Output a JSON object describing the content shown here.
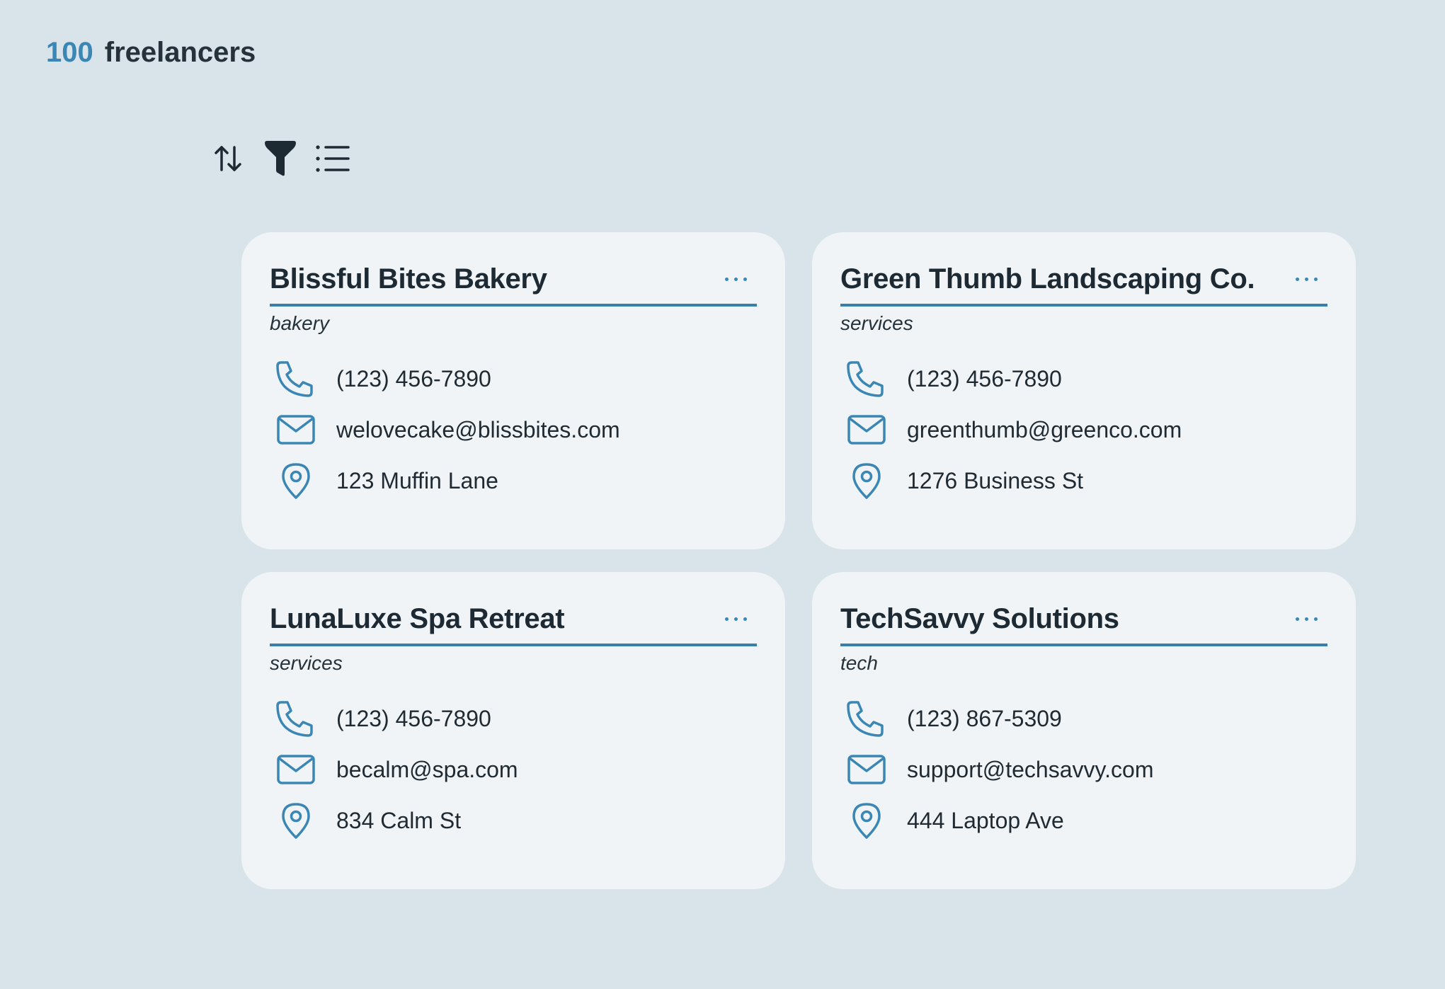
{
  "header": {
    "count": "100",
    "label": "freelancers"
  },
  "toolbar": {
    "sort_icon": "sort-arrows-icon",
    "filter_icon": "filter-funnel-icon",
    "list_icon": "list-view-icon"
  },
  "colors": {
    "accent": "#3a86b4",
    "background": "#d9e3ea",
    "card": "#f0f4f7"
  },
  "cards": [
    {
      "title": "Blissful Bites Bakery",
      "category": "bakery",
      "phone": "(123) 456-7890",
      "email": "welovecake@blissbites.com",
      "address": "123 Muffin Lane"
    },
    {
      "title": "Green Thumb Landscaping Co.",
      "category": "services",
      "phone": "(123) 456-7890",
      "email": "greenthumb@greenco.com",
      "address": "1276 Business St"
    },
    {
      "title": "LunaLuxe Spa Retreat",
      "category": "services",
      "phone": "(123) 456-7890",
      "email": "becalm@spa.com",
      "address": "834 Calm St"
    },
    {
      "title": "TechSavvy Solutions",
      "category": "tech",
      "phone": "(123) 867-5309",
      "email": "support@techsavvy.com",
      "address": "444 Laptop Ave"
    }
  ]
}
